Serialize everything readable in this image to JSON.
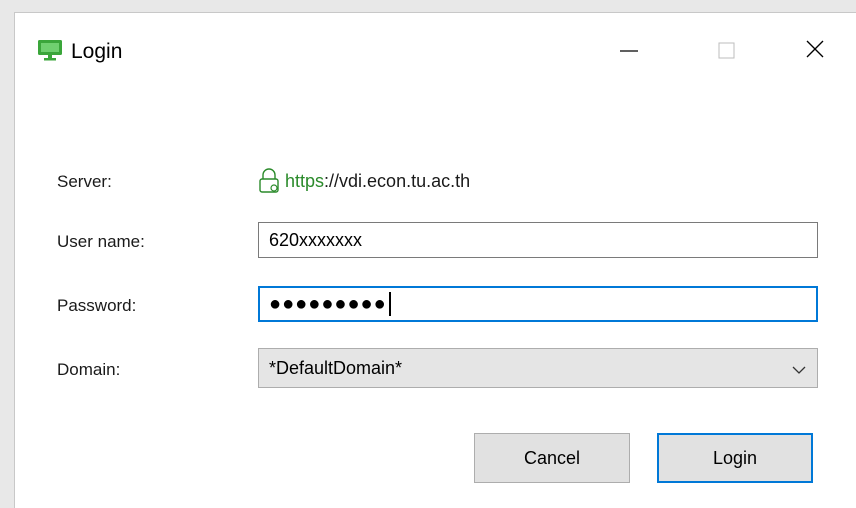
{
  "window": {
    "title": "Login",
    "controls": {
      "minimize": "minimize",
      "maximize": "maximize",
      "close": "close"
    }
  },
  "form": {
    "server": {
      "label": "Server:",
      "scheme": "https",
      "rest": "://vdi.econ.tu.ac.th"
    },
    "username": {
      "label": "User name:",
      "value": "620xxxxxxx"
    },
    "password": {
      "label": "Password:",
      "masked": "●●●●●●●●●"
    },
    "domain": {
      "label": "Domain:",
      "selected": "*DefaultDomain*"
    }
  },
  "buttons": {
    "cancel": "Cancel",
    "login": "Login"
  },
  "colors": {
    "accent": "#0078d7",
    "secure_green": "#2a8a2a",
    "app_icon_green": "#3aa63a"
  },
  "icons": {
    "app": "monitor-icon",
    "lock": "lock-icon",
    "chevron": "chevron-down-icon"
  }
}
